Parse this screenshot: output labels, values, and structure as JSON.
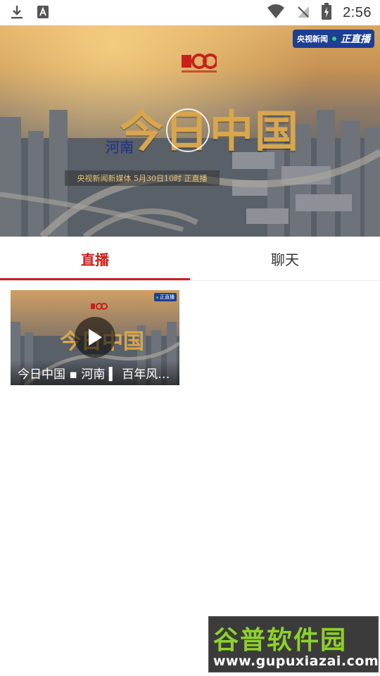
{
  "status_bar": {
    "time": "2:56",
    "icons": [
      "download-icon",
      "keyboard-a-icon",
      "wifi-icon",
      "no-signal-icon",
      "battery-charging-icon"
    ]
  },
  "hero": {
    "live_badge": {
      "brand": "央视新闻",
      "label": "正直播"
    },
    "title": "今日中国",
    "subtitle": "河南",
    "strip": "央视新闻新媒体 5月30日10时 正直播",
    "colors": {
      "gold": "#d9a64d",
      "badge_blue": "#1c3f94"
    }
  },
  "tabs": [
    {
      "label": "直播",
      "active": true
    },
    {
      "label": "聊天",
      "active": false
    }
  ],
  "video_list": [
    {
      "caption": "今日中国 ▪ 河南 ▍ 百年风…",
      "badge": "正直播"
    }
  ],
  "watermark": {
    "text": "谷普软件园",
    "url": "www.gupuxiazai.com"
  },
  "accent_color": "#c9201b"
}
